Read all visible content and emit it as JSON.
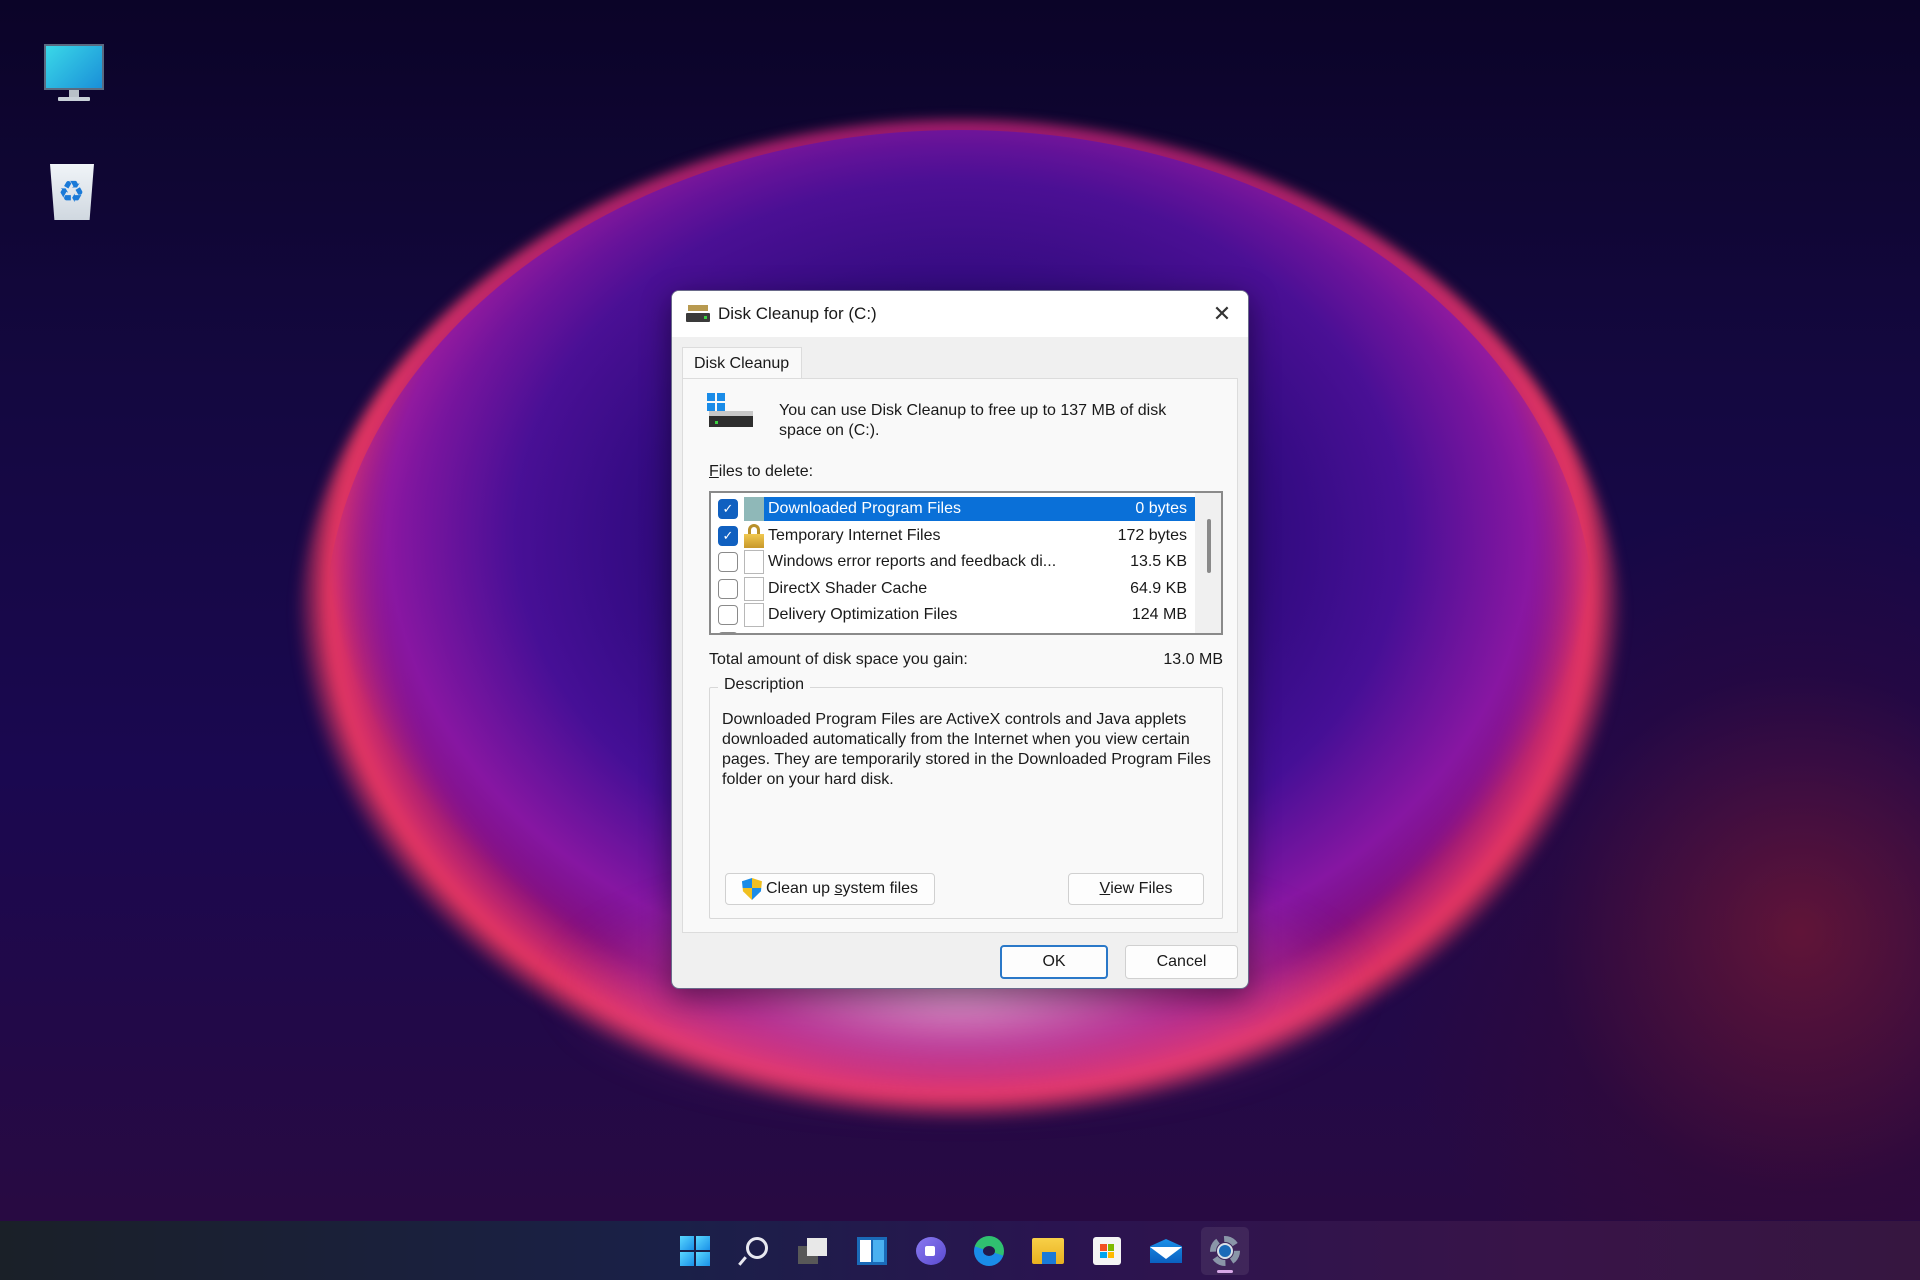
{
  "desktop": {
    "icons": [
      {
        "name": "This PC",
        "icon": "monitor-icon"
      },
      {
        "name": "Recycle Bin",
        "icon": "recycle-bin-icon"
      }
    ]
  },
  "dialog": {
    "title": "Disk Cleanup for  (C:)",
    "close_glyph": "✕",
    "tab_label": "Disk Cleanup",
    "intro_text": "You can use Disk Cleanup to free up to 137 MB of disk space on  (C:).",
    "files_label_accel": "F",
    "files_label_rest": "iles to delete:",
    "files": [
      {
        "name": "Downloaded Program Files",
        "size": "0 bytes",
        "checked": true,
        "selected": true,
        "icon": "folder-icon"
      },
      {
        "name": "Temporary Internet Files",
        "size": "172 bytes",
        "checked": true,
        "selected": false,
        "icon": "lock-icon"
      },
      {
        "name": "Windows error reports and feedback di...",
        "size": "13.5 KB",
        "checked": false,
        "selected": false,
        "icon": "document-icon"
      },
      {
        "name": "DirectX Shader Cache",
        "size": "64.9 KB",
        "checked": false,
        "selected": false,
        "icon": "document-icon"
      },
      {
        "name": "Delivery Optimization Files",
        "size": "124 MB",
        "checked": false,
        "selected": false,
        "icon": "document-icon"
      }
    ],
    "total_label": "Total amount of disk space you gain:",
    "total_value": "13.0 MB",
    "description_legend": "Description",
    "description_text": "Downloaded Program Files are ActiveX controls and Java applets downloaded automatically from the Internet when you view certain pages. They are temporarily stored in the Downloaded Program Files folder on your hard disk.",
    "cleanup_btn_pre": "Clean up ",
    "cleanup_btn_accel": "s",
    "cleanup_btn_post": "ystem files",
    "view_btn_accel": "V",
    "view_btn_post": "iew Files",
    "ok_label": "OK",
    "cancel_label": "Cancel"
  },
  "taskbar": {
    "items": [
      {
        "name": "Start",
        "icon": "windows-start-icon"
      },
      {
        "name": "Search",
        "icon": "search-icon"
      },
      {
        "name": "Task View",
        "icon": "task-view-icon"
      },
      {
        "name": "Widgets",
        "icon": "widgets-icon"
      },
      {
        "name": "Chat",
        "icon": "chat-icon"
      },
      {
        "name": "Microsoft Edge",
        "icon": "edge-icon"
      },
      {
        "name": "File Explorer",
        "icon": "file-explorer-icon"
      },
      {
        "name": "Microsoft Store",
        "icon": "store-icon"
      },
      {
        "name": "Mail",
        "icon": "mail-icon"
      },
      {
        "name": "Settings",
        "icon": "settings-gear-icon",
        "active": true
      }
    ]
  },
  "colors": {
    "selection": "#0a70d8",
    "checkbox_on": "#1060c0",
    "ok_border": "#2a78c8"
  }
}
